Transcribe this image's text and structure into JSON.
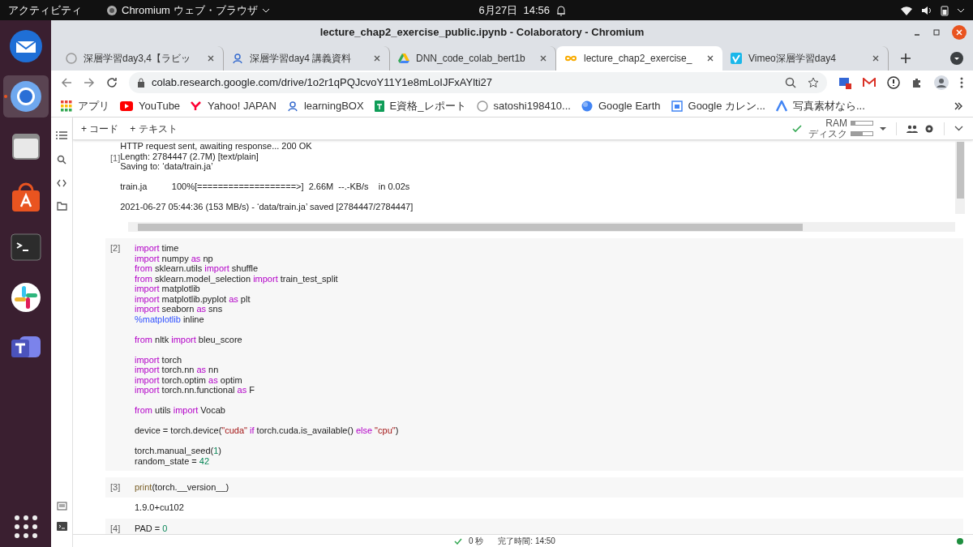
{
  "top_bar": {
    "activities": "アクティビティ",
    "app_menu": "Chromium ウェブ・ブラウザ",
    "date": "6月27日",
    "time": "14:56"
  },
  "dock": {
    "items": [
      {
        "selected": false
      },
      {
        "selected": true
      },
      {
        "selected": false
      },
      {
        "selected": false
      },
      {
        "selected": false
      },
      {
        "selected": false
      },
      {
        "selected": false
      }
    ]
  },
  "window": {
    "title": "lecture_chap2_exercise_public.ipynb - Colaboratory - Chromium"
  },
  "tabs": [
    {
      "label": "深層学習day3,4【ラビッ",
      "selected": false
    },
    {
      "label": "深層学習day4 講義資料",
      "selected": false
    },
    {
      "label": "DNN_code_colab_bert1b",
      "selected": false
    },
    {
      "label": "lecture_chap2_exercise_",
      "selected": true
    },
    {
      "label": "Vimeo深層学習day4",
      "selected": false
    }
  ],
  "address_bar": {
    "url": "colab.research.google.com/drive/1o2r1qPQJcvoY11Y1e8mLoIJFxAYlti27"
  },
  "bookmarks": [
    "アプリ",
    "YouTube",
    "Yahoo! JAPAN",
    "learningBOX",
    "E資格_レポート",
    "satoshi198410...",
    "Google Earth",
    "Google カレン...",
    "写真素材なら..."
  ],
  "colab_toolbar": {
    "add_code": "+ コード",
    "add_text": "+ テキスト",
    "resources": [
      {
        "label": "RAM",
        "level": 0.2
      },
      {
        "label": "ディスク",
        "level": 0.55
      }
    ]
  },
  "cells": [
    {
      "number": "[1]",
      "output_blocks": [
        [
          "HTTP request sent, awaiting response... 200 OK",
          "Length: 2784447 (2.7M) [text/plain]",
          "Saving to: ‘data/train.ja’"
        ],
        [
          "train.ja          100%[===================>]  2.66M  --.-KB/s    in 0.02s"
        ],
        [
          "2021-06-27 05:44:36 (153 MB/s) - ‘data/train.ja’ saved [2784447/2784447]"
        ]
      ]
    },
    {
      "number": "[2]",
      "code_blocks": [
        [
          [
            {
              "text": "import",
              "kind": "keyword"
            },
            {
              "text": " time",
              "kind": "plain"
            }
          ],
          [
            {
              "text": "import",
              "kind": "keyword"
            },
            {
              "text": " numpy ",
              "kind": "plain"
            },
            {
              "text": "as",
              "kind": "keyword"
            },
            {
              "text": " np",
              "kind": "plain"
            }
          ],
          [
            {
              "text": "from",
              "kind": "keyword"
            },
            {
              "text": " sklearn.utils ",
              "kind": "plain"
            },
            {
              "text": "import",
              "kind": "keyword"
            },
            {
              "text": " shuffle",
              "kind": "plain"
            }
          ],
          [
            {
              "text": "from",
              "kind": "keyword"
            },
            {
              "text": " sklearn.model_selection ",
              "kind": "plain"
            },
            {
              "text": "import",
              "kind": "keyword"
            },
            {
              "text": " train_test_split",
              "kind": "plain"
            }
          ],
          [
            {
              "text": "import",
              "kind": "keyword"
            },
            {
              "text": " matplotlib",
              "kind": "plain"
            }
          ],
          [
            {
              "text": "import",
              "kind": "keyword"
            },
            {
              "text": " matplotlib.pyplot ",
              "kind": "plain"
            },
            {
              "text": "as",
              "kind": "keyword"
            },
            {
              "text": " plt",
              "kind": "plain"
            }
          ],
          [
            {
              "text": "import",
              "kind": "keyword"
            },
            {
              "text": " seaborn ",
              "kind": "plain"
            },
            {
              "text": "as",
              "kind": "keyword"
            },
            {
              "text": " sns",
              "kind": "plain"
            }
          ],
          [
            {
              "text": "%matplotlib",
              "kind": "magic"
            },
            {
              "text": " inline",
              "kind": "plain"
            }
          ]
        ],
        [
          [
            {
              "text": "from",
              "kind": "keyword"
            },
            {
              "text": " nltk ",
              "kind": "plain"
            },
            {
              "text": "import",
              "kind": "keyword"
            },
            {
              "text": " bleu_score",
              "kind": "plain"
            }
          ]
        ],
        [
          [
            {
              "text": "import",
              "kind": "keyword"
            },
            {
              "text": " torch",
              "kind": "plain"
            }
          ],
          [
            {
              "text": "import",
              "kind": "keyword"
            },
            {
              "text": " torch.nn ",
              "kind": "plain"
            },
            {
              "text": "as",
              "kind": "keyword"
            },
            {
              "text": " nn",
              "kind": "plain"
            }
          ],
          [
            {
              "text": "import",
              "kind": "keyword"
            },
            {
              "text": " torch.optim ",
              "kind": "plain"
            },
            {
              "text": "as",
              "kind": "keyword"
            },
            {
              "text": " optim",
              "kind": "plain"
            }
          ],
          [
            {
              "text": "import",
              "kind": "keyword"
            },
            {
              "text": " torch.nn.functional ",
              "kind": "plain"
            },
            {
              "text": "as",
              "kind": "keyword"
            },
            {
              "text": " F",
              "kind": "plain"
            }
          ]
        ],
        [
          [
            {
              "text": "from",
              "kind": "keyword"
            },
            {
              "text": " utils ",
              "kind": "plain"
            },
            {
              "text": "import",
              "kind": "keyword"
            },
            {
              "text": " Vocab",
              "kind": "plain"
            }
          ]
        ],
        [
          [
            {
              "text": "device = torch.device(",
              "kind": "plain"
            },
            {
              "text": "\"cuda\" ",
              "kind": "string"
            },
            {
              "text": "if",
              "kind": "keyword"
            },
            {
              "text": " torch.cuda.is_available() ",
              "kind": "plain"
            },
            {
              "text": "else",
              "kind": "keyword"
            },
            {
              "text": " \"cpu\"",
              "kind": "string"
            },
            {
              "text": ")",
              "kind": "plain"
            }
          ]
        ],
        [
          [
            {
              "text": "torch.manual_seed(",
              "kind": "plain"
            },
            {
              "text": "1",
              "kind": "number"
            },
            {
              "text": ")",
              "kind": "plain"
            }
          ],
          [
            {
              "text": "random_state = ",
              "kind": "plain"
            },
            {
              "text": "42",
              "kind": "number"
            }
          ]
        ]
      ]
    },
    {
      "number": "[3]",
      "code_blocks": [
        [
          [
            {
              "text": "print",
              "kind": "builtin"
            },
            {
              "text": "(torch.__version__)",
              "kind": "plain"
            }
          ]
        ]
      ],
      "output_blocks": [
        [
          "1.9.0+cu102"
        ]
      ]
    },
    {
      "number": "[4]",
      "code_blocks": [
        [
          [
            {
              "text": "PAD = ",
              "kind": "plain"
            },
            {
              "text": "0",
              "kind": "number"
            }
          ]
        ]
      ]
    }
  ],
  "status_bar": {
    "duration": "0 秒",
    "finished": "完了時間: 14:50"
  }
}
